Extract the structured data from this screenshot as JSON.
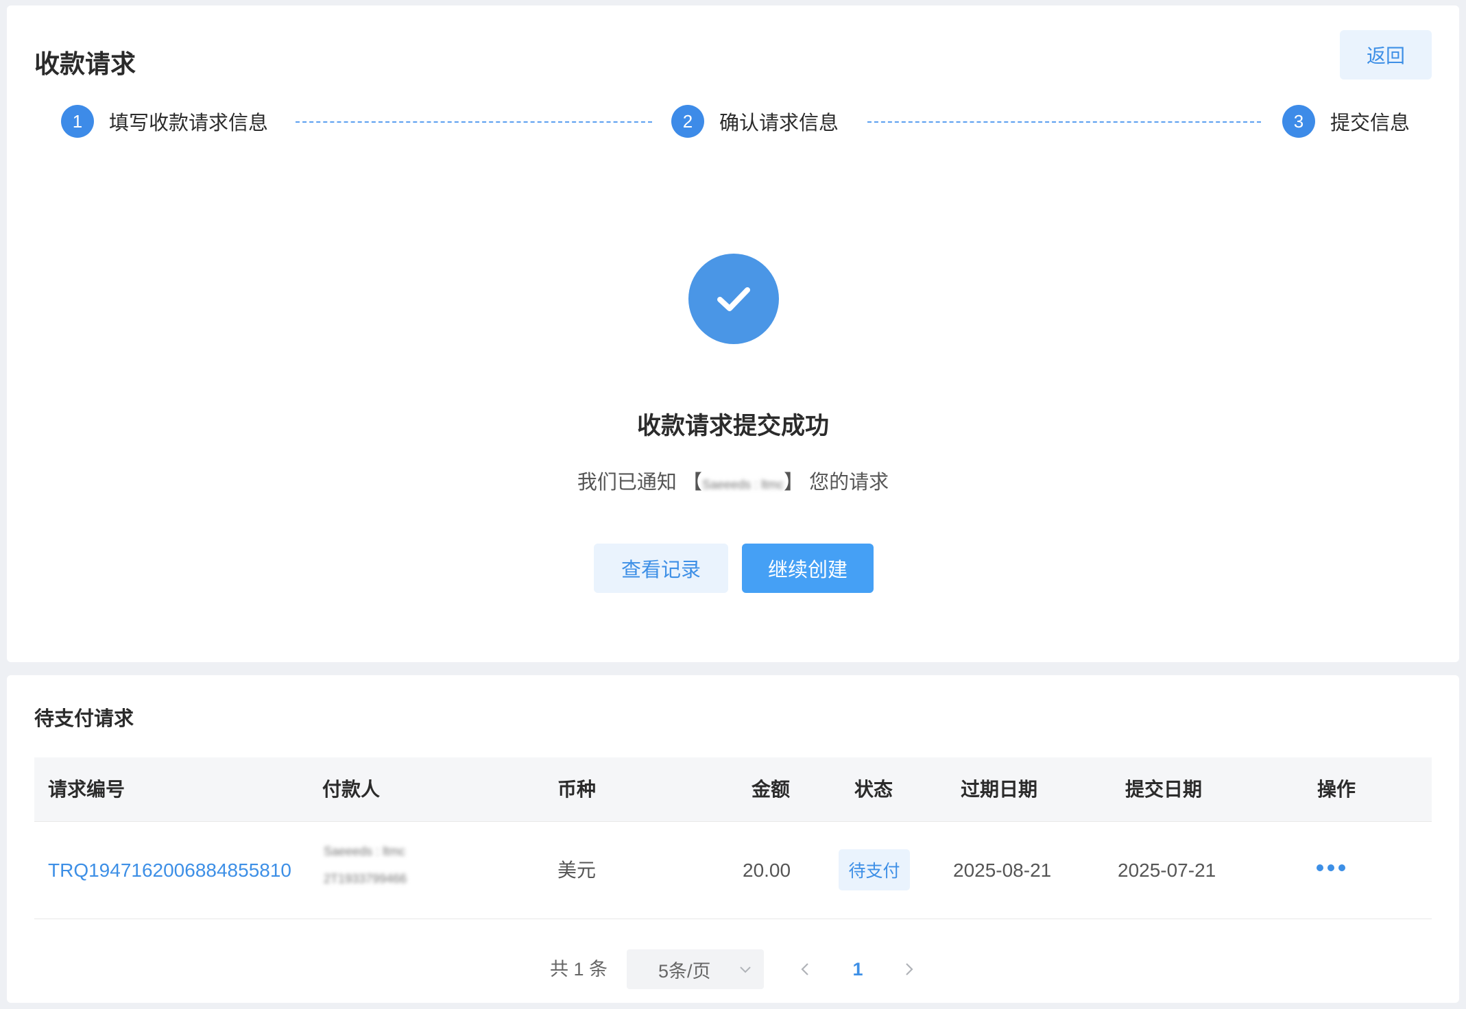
{
  "header": {
    "title": "收款请求",
    "back_label": "返回"
  },
  "steps": [
    {
      "number": "1",
      "label": "填写收款请求信息"
    },
    {
      "number": "2",
      "label": "确认请求信息"
    },
    {
      "number": "3",
      "label": "提交信息"
    }
  ],
  "success": {
    "icon": "check-circle-icon",
    "title": "收款请求提交成功",
    "msg_prefix": "我们已通知 【",
    "recipient_blurred": "Saeeeds : ltmc",
    "msg_suffix": "】 您的请求",
    "view_records_label": "查看记录",
    "continue_label": "继续创建"
  },
  "pending": {
    "title": "待支付请求",
    "columns": [
      "请求编号",
      "付款人",
      "币种",
      "金额",
      "状态",
      "过期日期",
      "提交日期",
      "操作"
    ],
    "rows": [
      {
        "request_id": "TRQ1947162006884855810",
        "payer_name": "Saeeeds : ltmc",
        "payer_account": "2T1933799466",
        "currency": "美元",
        "amount": "20.00",
        "status": "待支付",
        "expiry_date": "2025-08-21",
        "submit_date": "2025-07-21"
      }
    ]
  },
  "pagination": {
    "total": "共 1 条",
    "page_size": "5条/页",
    "current_page": "1"
  },
  "colors": {
    "accent": "#3d8fe6",
    "primary_button": "#45a0f5",
    "light_button_bg": "#eaf3fd",
    "page_bg": "#eef0f4"
  }
}
